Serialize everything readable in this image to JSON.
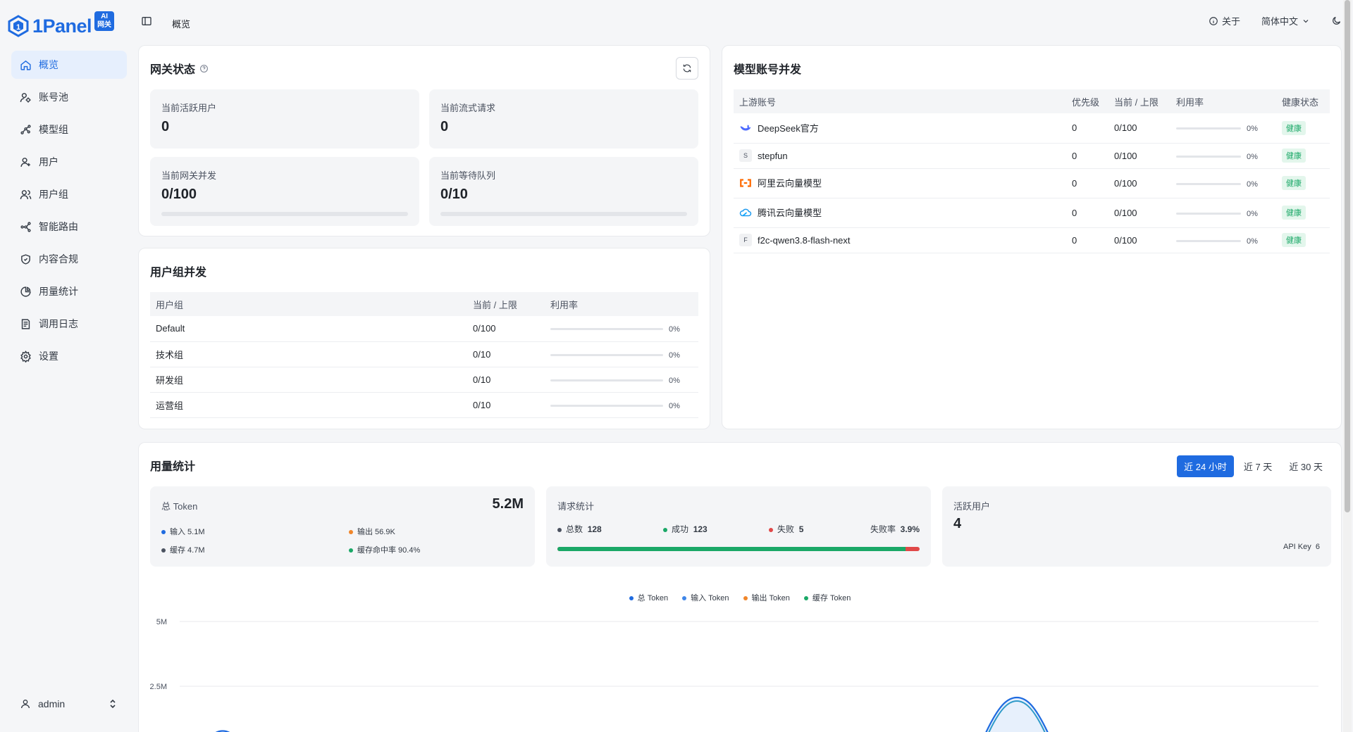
{
  "app": {
    "brand": "1Panel",
    "badge_line1": "AI",
    "badge_line2": "网关"
  },
  "sidebar": {
    "items": [
      {
        "label": "概览",
        "icon": "home-icon"
      },
      {
        "label": "账号池",
        "icon": "account-pool-icon"
      },
      {
        "label": "模型组",
        "icon": "model-group-icon"
      },
      {
        "label": "用户",
        "icon": "user-add-icon"
      },
      {
        "label": "用户组",
        "icon": "users-icon"
      },
      {
        "label": "智能路由",
        "icon": "route-icon"
      },
      {
        "label": "内容合规",
        "icon": "shield-icon"
      },
      {
        "label": "用量统计",
        "icon": "pie-chart-icon"
      },
      {
        "label": "调用日志",
        "icon": "log-icon"
      },
      {
        "label": "设置",
        "icon": "gear-icon"
      }
    ],
    "user": "admin"
  },
  "header": {
    "breadcrumb": "概览",
    "about": "关于",
    "language": "简体中文"
  },
  "gateway": {
    "title": "网关状态",
    "stats": [
      {
        "label": "当前活跃用户",
        "value": "0"
      },
      {
        "label": "当前流式请求",
        "value": "0"
      },
      {
        "label": "当前网关并发",
        "value": "0/100",
        "progress": 0
      },
      {
        "label": "当前等待队列",
        "value": "0/10",
        "progress": 0
      }
    ]
  },
  "group_conc": {
    "title": "用户组并发",
    "headers": [
      "用户组",
      "当前 / 上限",
      "利用率"
    ],
    "rows": [
      {
        "name": "Default",
        "cur": "0/100",
        "pct": "0%"
      },
      {
        "name": "技术组",
        "cur": "0/10",
        "pct": "0%"
      },
      {
        "name": "研发组",
        "cur": "0/10",
        "pct": "0%"
      },
      {
        "name": "运营组",
        "cur": "0/10",
        "pct": "0%"
      }
    ]
  },
  "model_conc": {
    "title": "模型账号并发",
    "headers": [
      "上游账号",
      "优先级",
      "当前 / 上限",
      "利用率",
      "健康状态"
    ],
    "rows": [
      {
        "name": "DeepSeek官方",
        "icon": "deepseek-icon",
        "prio": "0",
        "cur": "0/100",
        "pct": "0%",
        "health": "健康"
      },
      {
        "name": "stepfun",
        "icon": "letter-s",
        "letter": "S",
        "prio": "0",
        "cur": "0/100",
        "pct": "0%",
        "health": "健康"
      },
      {
        "name": "阿里云向量模型",
        "icon": "aliyun-icon",
        "prio": "0",
        "cur": "0/100",
        "pct": "0%",
        "health": "健康"
      },
      {
        "name": "腾讯云向量模型",
        "icon": "tencent-cloud-icon",
        "prio": "0",
        "cur": "0/100",
        "pct": "0%",
        "health": "健康"
      },
      {
        "name": "f2c-qwen3.8-flash-next",
        "icon": "letter-f",
        "letter": "F",
        "prio": "0",
        "cur": "0/100",
        "pct": "0%",
        "health": "健康"
      }
    ]
  },
  "usage": {
    "title": "用量统计",
    "ranges": [
      "近 24 小时",
      "近 7 天",
      "近 30 天"
    ],
    "token": {
      "label": "总 Token",
      "total": "5.2M",
      "input": "输入 5.1M",
      "output": "输出 56.9K",
      "cache": "缓存 4.7M",
      "hit": "缓存命中率 90.4%"
    },
    "requests": {
      "label": "请求统计",
      "total_label": "总数",
      "total": "128",
      "success_label": "成功",
      "success": "123",
      "fail_label": "失败",
      "fail": "5",
      "rate_label": "失败率",
      "rate": "3.9%",
      "success_ratio": 0.961
    },
    "active": {
      "label": "活跃用户",
      "value": "4",
      "apikey_label": "API Key",
      "apikey": "6"
    }
  },
  "chart_data": {
    "type": "line",
    "series": [
      {
        "name": "总 Token",
        "color": "#1f6be0"
      },
      {
        "name": "输入 Token",
        "color": "#3f86e8"
      },
      {
        "name": "输出 Token",
        "color": "#f0862a"
      },
      {
        "name": "缓存 Token",
        "color": "#1aa867"
      }
    ],
    "y_ticks": [
      "5M",
      "2.5M"
    ],
    "ylim": [
      0,
      5000000
    ],
    "grid": true,
    "legend": "top-center"
  },
  "colors": {
    "accent": "#1f6be0",
    "success": "#1aa867",
    "danger": "#e04848"
  }
}
